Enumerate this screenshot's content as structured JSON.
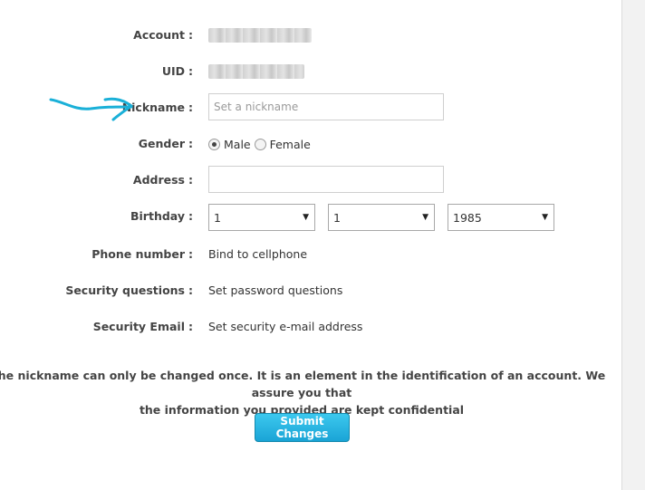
{
  "form": {
    "account": {
      "label": "Account",
      "colon": ":"
    },
    "uid": {
      "label": "UID",
      "colon": ":"
    },
    "nickname": {
      "label": "Nickname",
      "colon": ":",
      "placeholder": "Set a nickname",
      "value": ""
    },
    "gender": {
      "label": "Gender",
      "colon": ":",
      "options": [
        "Male",
        "Female"
      ],
      "selected": "Male"
    },
    "address": {
      "label": "Address",
      "colon": ":",
      "value": ""
    },
    "birthday": {
      "label": "Birthday",
      "colon": ":",
      "day": "1",
      "month": "1",
      "year": "1985"
    },
    "phone": {
      "label": "Phone number",
      "colon": ":",
      "action": "Bind to cellphone"
    },
    "security_questions": {
      "label": "Security questions",
      "colon": ":",
      "action": "Set password questions"
    },
    "security_email": {
      "label": "Security Email",
      "colon": ":",
      "action": "Set security e-mail address"
    }
  },
  "notice": {
    "line1": "he nickname can only be changed once. It is an element in the identification of an account. We assure you that",
    "line2": "the information you provided are kept confidential"
  },
  "submit_label": "Submit Changes",
  "colors": {
    "accent": "#1aa4d6",
    "annotation": "#1ab0d8"
  }
}
